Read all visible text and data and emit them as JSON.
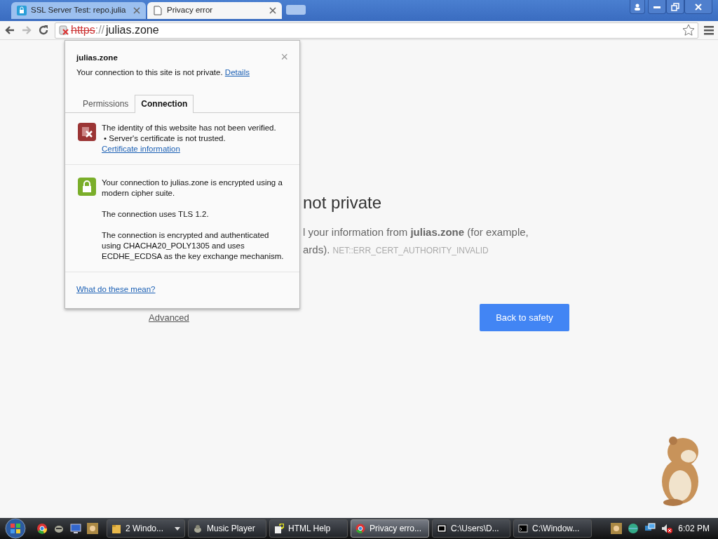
{
  "tabs": [
    {
      "title": "SSL Server Test: repo.julia",
      "selected": false,
      "kind": "secure"
    },
    {
      "title": "Privacy error",
      "selected": true,
      "kind": "page"
    }
  ],
  "address_bar": {
    "scheme": "https",
    "separator": "://",
    "host": "julias.zone"
  },
  "page": {
    "heading": "not private",
    "line_1": "l your information from **julias.zone** (for example,",
    "line_2": "ards).",
    "error_code": "NET::ERR_CERT_AUTHORITY_INVALID",
    "advanced_link": "Advanced",
    "primary_button": "Back to safety"
  },
  "popup": {
    "site": "julias.zone",
    "summary": "Your connection to this site is not private.",
    "details_link": "Details",
    "close": "×",
    "tabs": [
      {
        "label": "Permissions",
        "selected": false
      },
      {
        "label": "Connection",
        "selected": true
      }
    ],
    "sections": [
      {
        "kind": "error",
        "lines": [
          "The identity of this website has not been verified.",
          "• Server's certificate is not trusted."
        ],
        "link": "Certificate information"
      },
      {
        "kind": "secure",
        "lines": [
          "Your connection to julias.zone is encrypted using a modern cipher suite.",
          "The connection uses TLS 1.2.",
          "The connection is encrypted and authenticated using CHACHA20_POLY1305 and uses ECDHE_ECDSA as the key exchange mechanism."
        ]
      }
    ],
    "help_link": "What do these mean?"
  },
  "taskbar": {
    "buttons": [
      {
        "label": "2 Windo...",
        "selected": false,
        "dropdown": true
      },
      {
        "label": "Music Player",
        "selected": false
      },
      {
        "label": "HTML Help",
        "selected": false
      },
      {
        "label": "Privacy erro...",
        "selected": true
      },
      {
        "label": "C:\\Users\\D...",
        "selected": false
      },
      {
        "label": "C:\\Window...",
        "selected": false
      }
    ],
    "clock": "6:02 PM"
  }
}
